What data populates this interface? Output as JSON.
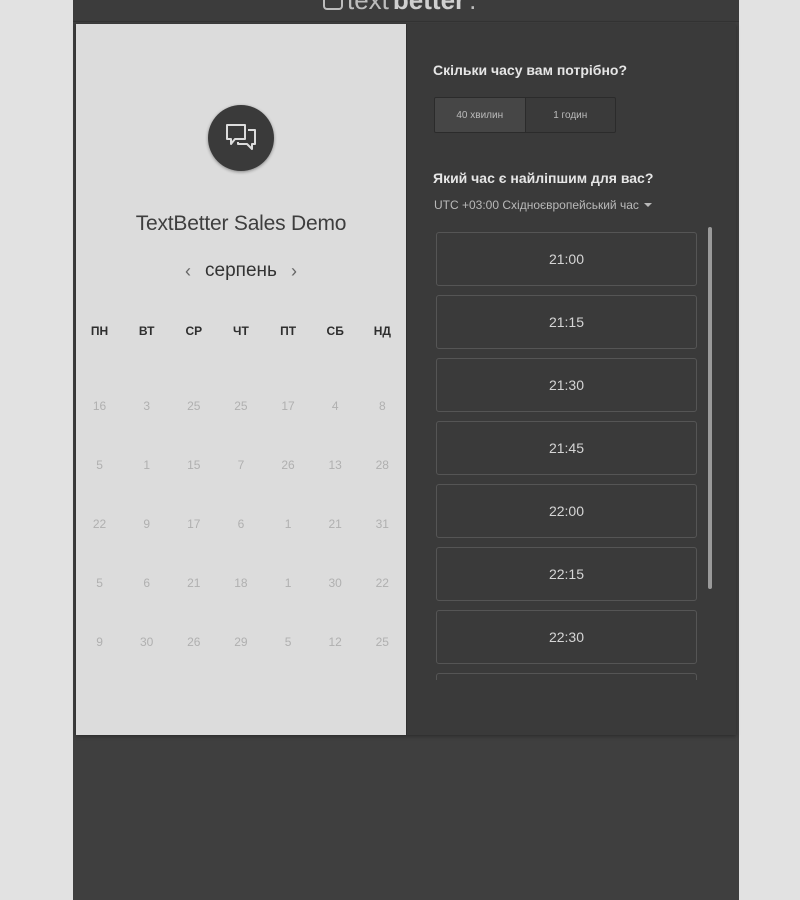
{
  "brand": {
    "text_light": "text",
    "text_bold": "better",
    "text_dot": "."
  },
  "company_name": "TextBetter Sales Demo",
  "calendar": {
    "month": "серпень",
    "prev_icon": "chevron-left-icon",
    "next_icon": "chevron-right-icon",
    "weekdays": [
      "ПН",
      "ВТ",
      "СР",
      "ЧТ",
      "ПТ",
      "СБ",
      "НД"
    ],
    "rows": [
      [
        "16",
        "3",
        "25",
        "25",
        "17",
        "4",
        "8"
      ],
      [
        "5",
        "1",
        "15",
        "7",
        "26",
        "13",
        "28"
      ],
      [
        "22",
        "9",
        "17",
        "6",
        "1",
        "21",
        "31"
      ],
      [
        "5",
        "6",
        "21",
        "18",
        "1",
        "30",
        "22"
      ],
      [
        "9",
        "30",
        "26",
        "29",
        "5",
        "12",
        "25"
      ]
    ]
  },
  "scheduler": {
    "duration_question": "Скільки часу вам потрібно?",
    "duration_options": [
      "40 хвилин",
      "1 годин"
    ],
    "duration_selected": "40 хвилин",
    "time_question": "Який час є найліпшим для вас?",
    "timezone": "UTC +03:00 Східноєвропейський час",
    "slots": [
      "21:00",
      "21:15",
      "21:30",
      "21:45",
      "22:00",
      "22:15",
      "22:30",
      ""
    ]
  },
  "colors": {
    "page_bg": "#e2e2e2",
    "dark_panel": "#3a3a3a",
    "light_panel": "#dcdcdc"
  }
}
